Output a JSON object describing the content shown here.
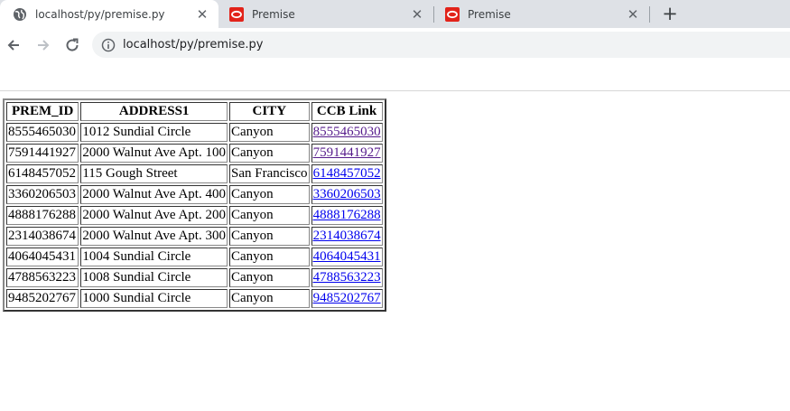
{
  "browser": {
    "tabs": [
      {
        "title": "localhost/py/premise.py",
        "icon": "globe-icon",
        "active": true
      },
      {
        "title": "Premise",
        "icon": "oracle-icon",
        "active": false
      },
      {
        "title": "Premise",
        "icon": "oracle-icon",
        "active": false
      }
    ],
    "new_tab_label": "+",
    "close_label": "✕",
    "address": "localhost/py/premise.py"
  },
  "table": {
    "headers": [
      "PREM_ID",
      "ADDRESS1",
      "CITY",
      "CCB Link"
    ],
    "rows": [
      {
        "prem_id": "8555465030",
        "address": "1012 Sundial Circle",
        "city": "Canyon",
        "link": "8555465030",
        "visited": true
      },
      {
        "prem_id": "7591441927",
        "address": "2000 Walnut Ave Apt. 100",
        "city": "Canyon",
        "link": "7591441927",
        "visited": true
      },
      {
        "prem_id": "6148457052",
        "address": "115 Gough Street",
        "city": "San Francisco",
        "link": "6148457052",
        "visited": false
      },
      {
        "prem_id": "3360206503",
        "address": "2000 Walnut Ave Apt. 400",
        "city": "Canyon",
        "link": "3360206503",
        "visited": false
      },
      {
        "prem_id": "4888176288",
        "address": "2000 Walnut Ave Apt. 200",
        "city": "Canyon",
        "link": "4888176288",
        "visited": false
      },
      {
        "prem_id": "2314038674",
        "address": "2000 Walnut Ave Apt. 300",
        "city": "Canyon",
        "link": "2314038674",
        "visited": false
      },
      {
        "prem_id": "4064045431",
        "address": "1004 Sundial Circle",
        "city": "Canyon",
        "link": "4064045431",
        "visited": false
      },
      {
        "prem_id": "4788563223",
        "address": "1008 Sundial Circle",
        "city": "Canyon",
        "link": "4788563223",
        "visited": false
      },
      {
        "prem_id": "9485202767",
        "address": "1000 Sundial Circle",
        "city": "Canyon",
        "link": "9485202767",
        "visited": false
      }
    ]
  }
}
